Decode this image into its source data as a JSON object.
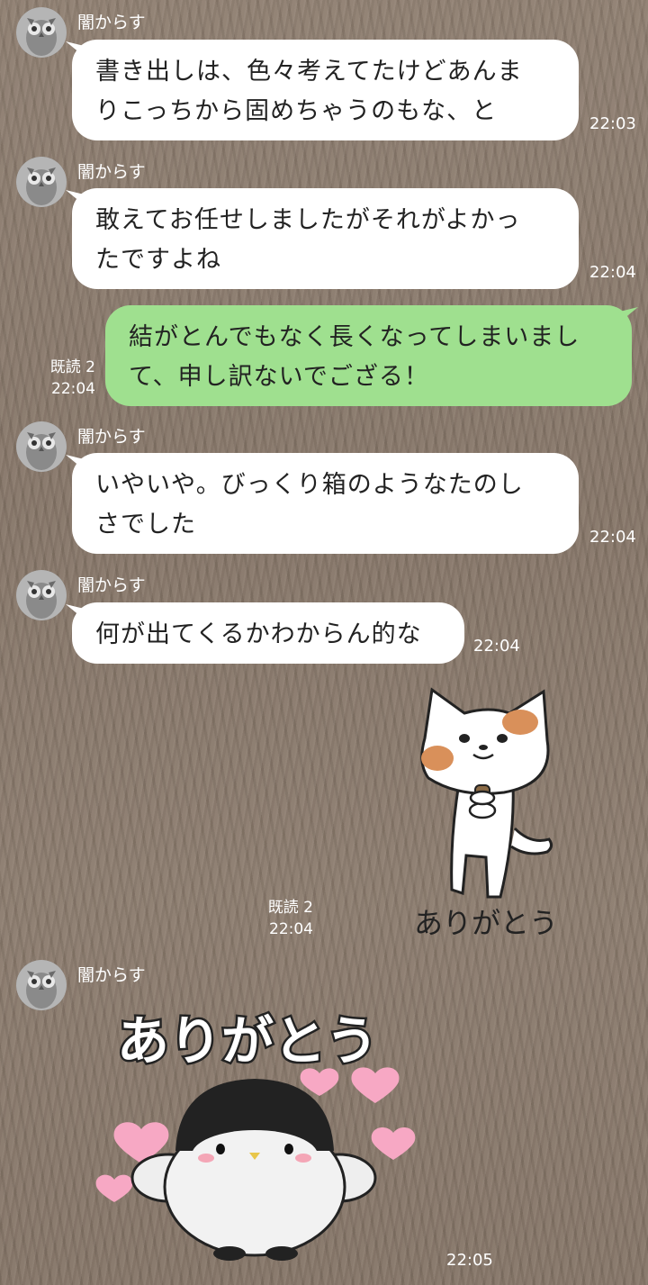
{
  "colors": {
    "incoming_bubble": "#ffffff",
    "outgoing_bubble": "#9fe08f",
    "text": "#222222",
    "meta_text": "#ffffff",
    "background": "#8a7a6c"
  },
  "messages": [
    {
      "sender": "闇からす",
      "line1": "書き出しは、色々考えてたけどあんま",
      "line2": "りこっちから固めちゃうのもな、と",
      "time": "22:03"
    },
    {
      "sender": "闇からす",
      "line1": "敢えてお任せしましたがそれがよかっ",
      "line2": "たですよね",
      "time": "22:04"
    },
    {
      "line1": "結がとんでもなく長くなってしまいまし",
      "line2": "て、申し訳ないでござる！",
      "read": "既読 2",
      "time": "22:04"
    },
    {
      "sender": "闇からす",
      "line1": "いやいや。びっくり箱のようなたのし",
      "line2": "さでした",
      "time": "22:04"
    },
    {
      "sender": "闇からす",
      "line1": "何が出てくるかわからん的な",
      "time": "22:04"
    }
  ],
  "sticker_cat": {
    "caption": "ありがとう",
    "read": "既読 2",
    "time": "22:04",
    "icon": "cat-sticker"
  },
  "sticker_penguin": {
    "sender": "闇からす",
    "caption": "ありがとう",
    "time": "22:05",
    "icon": "penguin-sticker"
  }
}
